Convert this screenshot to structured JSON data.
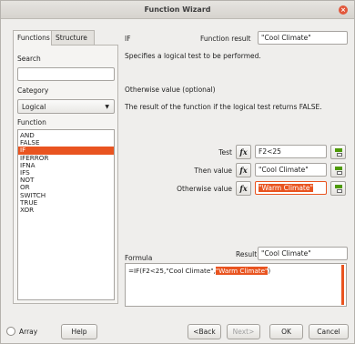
{
  "window": {
    "title": "Function Wizard"
  },
  "tabs": [
    {
      "label": "Functions"
    },
    {
      "label": "Structure"
    }
  ],
  "search": {
    "label": "Search",
    "value": ""
  },
  "category": {
    "label": "Category",
    "value": "Logical"
  },
  "function_list": {
    "label": "Function",
    "items": [
      "AND",
      "FALSE",
      "IF",
      "IFERROR",
      "IFNA",
      "IFS",
      "NOT",
      "OR",
      "SWITCH",
      "TRUE",
      "XOR"
    ],
    "selected": "IF"
  },
  "function_name": "IF",
  "function_result": {
    "label": "Function result",
    "value": "\"Cool Climate\""
  },
  "description": "Specifies a logical test to be performed.",
  "argument_title": "Otherwise value (optional)",
  "argument_description": "The result of the function if the logical test returns FALSE.",
  "args": {
    "test": {
      "label": "Test",
      "value": "F2<25"
    },
    "then": {
      "label": "Then value",
      "value": "\"Cool Climate\""
    },
    "otherwise": {
      "label": "Otherwise value",
      "value": "\"Warm Climate\""
    },
    "fx_label": "fx"
  },
  "formula": {
    "label": "Formula",
    "result_label": "Result",
    "result_value": "\"Cool Climate\"",
    "text_prefix": "=IF(F2<25,\"Cool Climate\",",
    "text_highlight": "\"Warm Climate\"",
    "text_suffix": ")"
  },
  "footer": {
    "array_label": "Array",
    "help": "Help",
    "back": "<Back",
    "next": "Next>",
    "ok": "OK",
    "cancel": "Cancel"
  },
  "colors": {
    "accent": "#e95420",
    "shrink_icon": "#4e9a06"
  }
}
